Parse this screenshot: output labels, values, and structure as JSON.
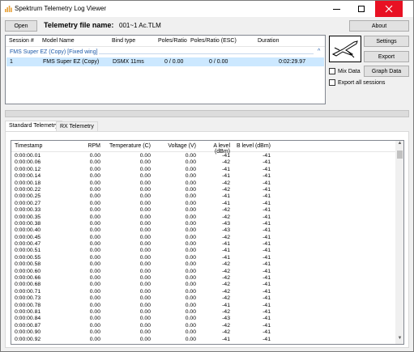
{
  "window": {
    "title": "Spektrum Telemetry Log Viewer"
  },
  "toolbar": {
    "open_label": "Open",
    "file_label": "Telemetry file name:",
    "file_name": "001~1 Ac.TLM",
    "about_label": "About",
    "settings_label": "Settings",
    "export_label": "Export",
    "graph_label": "Graph Data",
    "mix_label": "Mix Data",
    "export_all_label": "Export all sessions"
  },
  "sessions": {
    "columns": [
      "Session #",
      "Model Name",
      "Bind type",
      "Poles/Ratio",
      "Poles/Ratio (ESC)",
      "Duration"
    ],
    "group_label": "FMS Super EZ (Copy) [Fixed wing]",
    "row": {
      "session": "1",
      "model": "FMS Super EZ (Copy)",
      "bind": "DSMX 11ms",
      "poles": "0 / 0.00",
      "poles_esc": "0 / 0.00",
      "duration": "0:02:29.97"
    }
  },
  "tabs": {
    "standard": "Standard Telemetry",
    "rx": "RX Telemetry"
  },
  "grid": {
    "columns": {
      "timestamp": "Timestamp",
      "rpm": "RPM",
      "temperature": "Temperature (C)",
      "voltage": "Voltage (V)",
      "a_level": "A level (dBm)",
      "b_level": "B level (dBm)"
    },
    "rows": [
      {
        "ts": "0:00:00.01",
        "rpm": "0.00",
        "temp": "0.00",
        "volt": "0.00",
        "a": "-41",
        "b": "-41"
      },
      {
        "ts": "0:00:00.06",
        "rpm": "0.00",
        "temp": "0.00",
        "volt": "0.00",
        "a": "-42",
        "b": "-41"
      },
      {
        "ts": "0:00:00.12",
        "rpm": "0.00",
        "temp": "0.00",
        "volt": "0.00",
        "a": "-41",
        "b": "-41"
      },
      {
        "ts": "0:00:00.14",
        "rpm": "0.00",
        "temp": "0.00",
        "volt": "0.00",
        "a": "-41",
        "b": "-41"
      },
      {
        "ts": "0:00:00.18",
        "rpm": "0.00",
        "temp": "0.00",
        "volt": "0.00",
        "a": "-42",
        "b": "-41"
      },
      {
        "ts": "0:00:00.22",
        "rpm": "0.00",
        "temp": "0.00",
        "volt": "0.00",
        "a": "-42",
        "b": "-41"
      },
      {
        "ts": "0:00:00.25",
        "rpm": "0.00",
        "temp": "0.00",
        "volt": "0.00",
        "a": "-41",
        "b": "-41"
      },
      {
        "ts": "0:00:00.27",
        "rpm": "0.00",
        "temp": "0.00",
        "volt": "0.00",
        "a": "-41",
        "b": "-41"
      },
      {
        "ts": "0:00:00.33",
        "rpm": "0.00",
        "temp": "0.00",
        "volt": "0.00",
        "a": "-42",
        "b": "-41"
      },
      {
        "ts": "0:00:00.35",
        "rpm": "0.00",
        "temp": "0.00",
        "volt": "0.00",
        "a": "-42",
        "b": "-41"
      },
      {
        "ts": "0:00:00.38",
        "rpm": "0.00",
        "temp": "0.00",
        "volt": "0.00",
        "a": "-43",
        "b": "-41"
      },
      {
        "ts": "0:00:00.40",
        "rpm": "0.00",
        "temp": "0.00",
        "volt": "0.00",
        "a": "-43",
        "b": "-41"
      },
      {
        "ts": "0:00:00.45",
        "rpm": "0.00",
        "temp": "0.00",
        "volt": "0.00",
        "a": "-42",
        "b": "-41"
      },
      {
        "ts": "0:00:00.47",
        "rpm": "0.00",
        "temp": "0.00",
        "volt": "0.00",
        "a": "-41",
        "b": "-41"
      },
      {
        "ts": "0:00:00.51",
        "rpm": "0.00",
        "temp": "0.00",
        "volt": "0.00",
        "a": "-41",
        "b": "-41"
      },
      {
        "ts": "0:00:00.55",
        "rpm": "0.00",
        "temp": "0.00",
        "volt": "0.00",
        "a": "-41",
        "b": "-41"
      },
      {
        "ts": "0:00:00.58",
        "rpm": "0.00",
        "temp": "0.00",
        "volt": "0.00",
        "a": "-42",
        "b": "-41"
      },
      {
        "ts": "0:00:00.60",
        "rpm": "0.00",
        "temp": "0.00",
        "volt": "0.00",
        "a": "-42",
        "b": "-41"
      },
      {
        "ts": "0:00:00.66",
        "rpm": "0.00",
        "temp": "0.00",
        "volt": "0.00",
        "a": "-42",
        "b": "-41"
      },
      {
        "ts": "0:00:00.68",
        "rpm": "0.00",
        "temp": "0.00",
        "volt": "0.00",
        "a": "-42",
        "b": "-41"
      },
      {
        "ts": "0:00:00.71",
        "rpm": "0.00",
        "temp": "0.00",
        "volt": "0.00",
        "a": "-42",
        "b": "-41"
      },
      {
        "ts": "0:00:00.73",
        "rpm": "0.00",
        "temp": "0.00",
        "volt": "0.00",
        "a": "-42",
        "b": "-41"
      },
      {
        "ts": "0:00:00.78",
        "rpm": "0.00",
        "temp": "0.00",
        "volt": "0.00",
        "a": "-41",
        "b": "-41"
      },
      {
        "ts": "0:00:00.81",
        "rpm": "0.00",
        "temp": "0.00",
        "volt": "0.00",
        "a": "-42",
        "b": "-41"
      },
      {
        "ts": "0:00:00.84",
        "rpm": "0.00",
        "temp": "0.00",
        "volt": "0.00",
        "a": "-43",
        "b": "-41"
      },
      {
        "ts": "0:00:00.87",
        "rpm": "0.00",
        "temp": "0.00",
        "volt": "0.00",
        "a": "-42",
        "b": "-41"
      },
      {
        "ts": "0:00:00.90",
        "rpm": "0.00",
        "temp": "0.00",
        "volt": "0.00",
        "a": "-42",
        "b": "-41"
      },
      {
        "ts": "0:00:00.92",
        "rpm": "0.00",
        "temp": "0.00",
        "volt": "0.00",
        "a": "-41",
        "b": "-41"
      }
    ]
  },
  "colors": {
    "selection": "#cce8ff",
    "group_text": "#1e5aa8",
    "close_button": "#e81123",
    "app_icon": "#e8a23a"
  }
}
